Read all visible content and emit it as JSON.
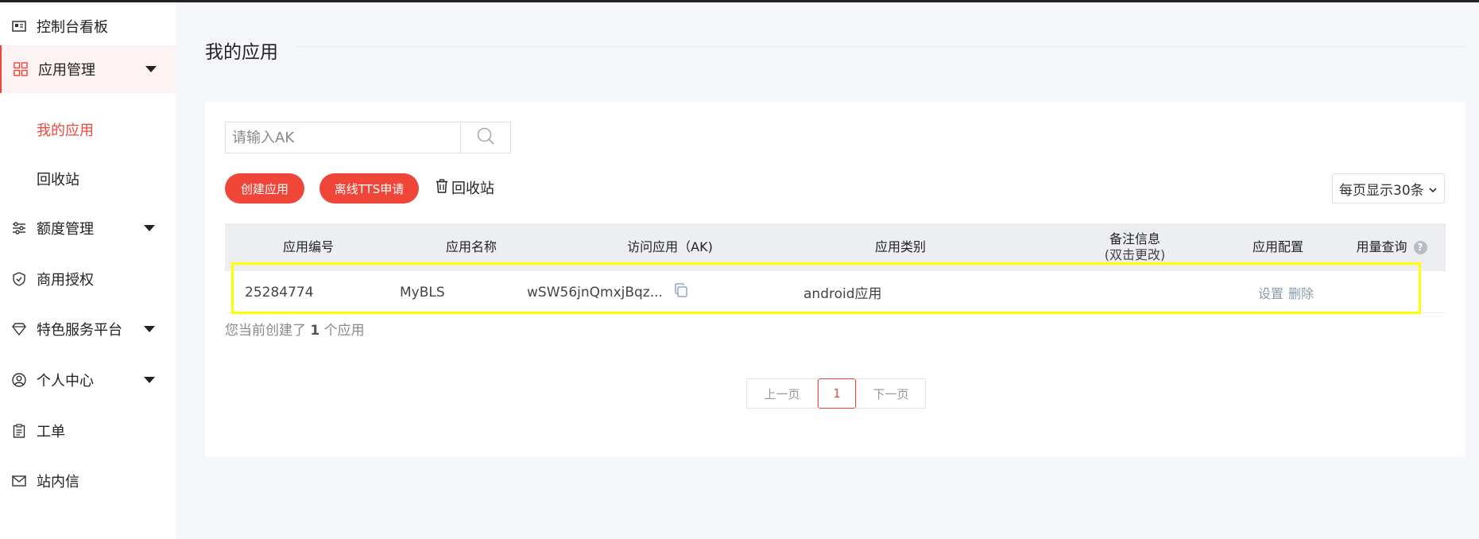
{
  "sidebar": {
    "items": [
      {
        "label": "控制台看板"
      },
      {
        "label": "应用管理"
      },
      {
        "label": "我的应用"
      },
      {
        "label": "回收站"
      },
      {
        "label": "额度管理"
      },
      {
        "label": "商用授权"
      },
      {
        "label": "特色服务平台"
      },
      {
        "label": "个人中心"
      },
      {
        "label": "工单"
      },
      {
        "label": "站内信"
      }
    ]
  },
  "main": {
    "title": "我的应用",
    "search_placeholder": "请输入AK",
    "create_button": "创建应用",
    "tts_button": "离线TTS申请",
    "recycle_link": "回收站",
    "page_size": "每页显示30条",
    "columns": {
      "id": "应用编号",
      "name": "应用名称",
      "ak": "访问应用（AK)",
      "category": "应用类别",
      "note": "备注信息",
      "note_sub": "(双击更改)",
      "config": "应用配置",
      "usage": "用量查询"
    },
    "rows": [
      {
        "id": "25284774",
        "name": "MyBLS",
        "ak": "wSW56jnQmxjBqz...",
        "category": "android应用",
        "note": "",
        "settings": "设置",
        "delete": "删除"
      }
    ],
    "count_prefix": "您当前创建了",
    "count": "1",
    "count_suffix": "个应用",
    "pager": {
      "prev": "上一页",
      "current": "1",
      "next": "下一页"
    }
  },
  "colors": {
    "accent": "#f0463a",
    "highlight": "#ffff00"
  }
}
